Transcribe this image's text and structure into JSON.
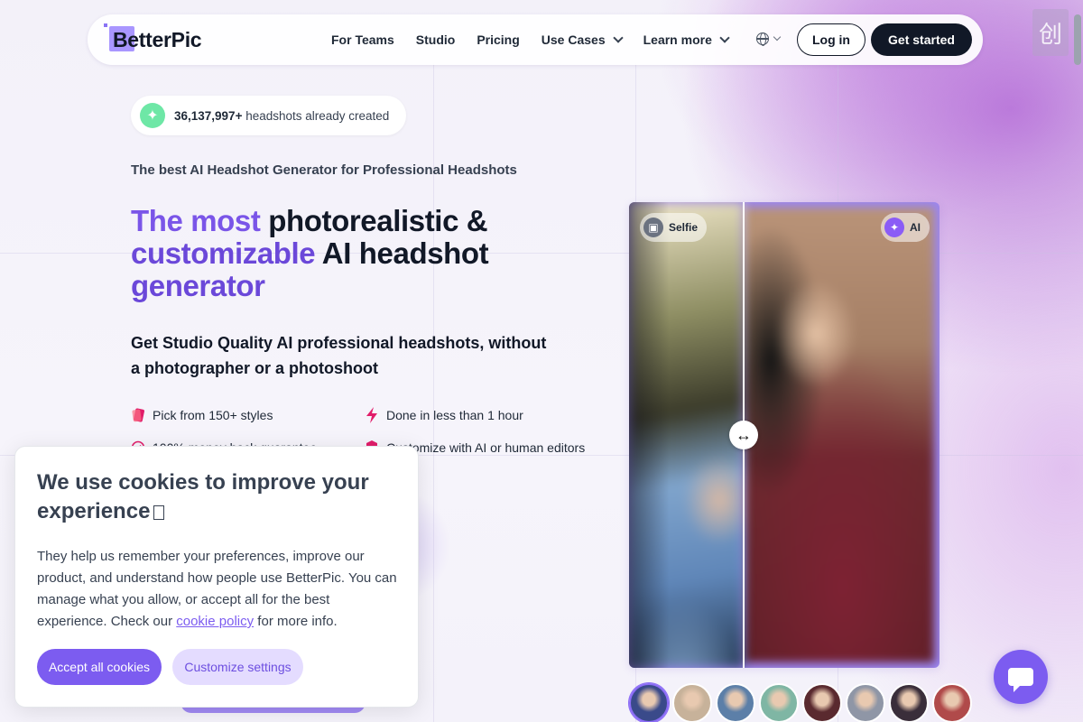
{
  "nav": {
    "logo": "BetterPic",
    "links": [
      {
        "label": "For Teams",
        "dropdown": false
      },
      {
        "label": "Studio",
        "dropdown": false
      },
      {
        "label": "Pricing",
        "dropdown": false
      },
      {
        "label": "Use Cases",
        "dropdown": true
      },
      {
        "label": "Learn more",
        "dropdown": true
      }
    ],
    "login_label": "Log in",
    "get_started_label": "Get started",
    "corner_badge": "创"
  },
  "hero": {
    "counter_number": "36,137,997+",
    "counter_suffix": " headshots already created",
    "subtitle": "The best AI Headshot Generator for Professional Headshots",
    "headline_part1": "The most ",
    "headline_part2": "photorealistic & ",
    "headline_part3": "customizable",
    "headline_part4": " AI headshot ",
    "headline_part5": "generator",
    "lead": "Get Studio Quality AI professional headshots, without a photographer or a photoshoot",
    "features": [
      "Pick from 150+ styles",
      "Done in less than 1 hour",
      "100% money back guarantee",
      "Customize with AI or human editors"
    ]
  },
  "compare": {
    "selfie_label": "Selfie",
    "ai_label": "AI",
    "handle_glyph": "↔",
    "split_fraction": 0.37
  },
  "cookie": {
    "title": "We use cookies to improve your experience",
    "body_pre": "They help us remember your preferences, improve our product, and understand how people use BetterPic. You can manage what you allow, or accept all for the best experience. Check our ",
    "link_text": "cookie policy",
    "body_post": " for more info.",
    "accept_label": "Accept all cookies",
    "customize_label": "Customize settings"
  },
  "avatars": [
    {
      "name": "avatar-1",
      "color": "#3a4a8a",
      "active": true
    },
    {
      "name": "avatar-2",
      "color": "#c7b29a",
      "active": false
    },
    {
      "name": "avatar-3",
      "color": "#5c7fa8",
      "active": false
    },
    {
      "name": "avatar-4",
      "color": "#7fb6a4",
      "active": false
    },
    {
      "name": "avatar-5",
      "color": "#5a2a2f",
      "active": false
    },
    {
      "name": "avatar-6",
      "color": "#8f96a6",
      "active": false
    },
    {
      "name": "avatar-7",
      "color": "#3a2e3a",
      "active": false
    },
    {
      "name": "avatar-8",
      "color": "#b04a4a",
      "active": false
    }
  ],
  "colors": {
    "accent": "#7c5cf0",
    "dark": "#111827",
    "headline_gradient": "#7a55e8"
  }
}
